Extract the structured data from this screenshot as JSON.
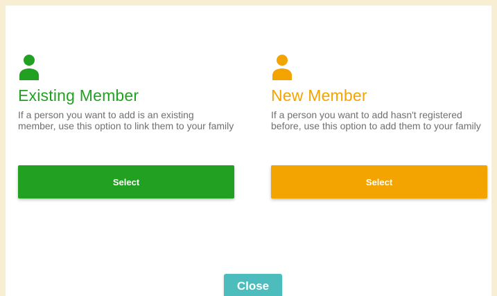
{
  "colors": {
    "existing": "#22a021",
    "new": "#f4a400",
    "close": "#4dbcbc",
    "page_background": "#f8eed4"
  },
  "existing_member": {
    "icon": "person-icon",
    "title": "Existing Member",
    "description": "If a person you want to add is an existing member, use this option to link them to your family",
    "button_label": "Select"
  },
  "new_member": {
    "icon": "person-icon",
    "title": "New Member",
    "description": "If a person you want to add hasn't registered before, use this option to add them to your family",
    "button_label": "Select"
  },
  "footer": {
    "close_label": "Close"
  }
}
